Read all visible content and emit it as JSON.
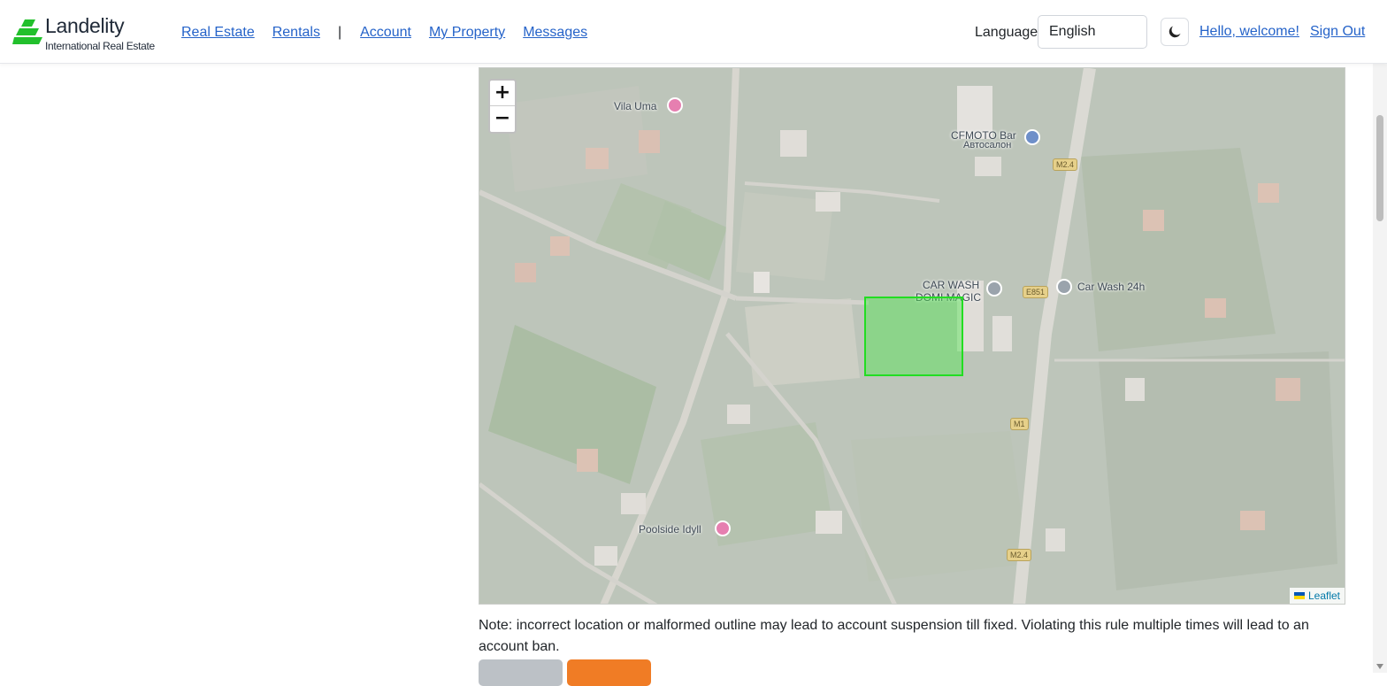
{
  "header": {
    "logo": {
      "name": "Landelity",
      "tagline": "International Real Estate",
      "color": "#22c02c"
    },
    "nav": [
      {
        "label": "Real Estate"
      },
      {
        "label": "Rentals"
      },
      {
        "separator": "|"
      },
      {
        "label": "Account"
      },
      {
        "label": "My Property"
      },
      {
        "label": "Messages"
      }
    ],
    "language_label": "Language",
    "language_value": "English",
    "theme_icon": "moon-icon",
    "greeting": "Hello, welcome!",
    "sign_out": "Sign Out"
  },
  "map": {
    "zoom_in": "+",
    "zoom_out": "−",
    "polygon_color": "#22dd22",
    "labels": {
      "vila": "Vila Uma",
      "bar": "CFMOTO Bar",
      "bar_sub": "Автосалон",
      "carwash1": "CAR WASH",
      "carwash1_sub": "DOMI MAGIC",
      "carwash2": "Car Wash 24h",
      "poolside": "Poolside Idyll"
    },
    "road_shields": {
      "m24_top": "M2.4",
      "e851": "E851",
      "m1": "M1",
      "m24_bottom": "M2.4"
    },
    "attribution": "Leaflet"
  },
  "note": "Note: incorrect location or malformed outline may lead to account suspension till fixed. Violating this rule multiple times will lead to an account ban."
}
